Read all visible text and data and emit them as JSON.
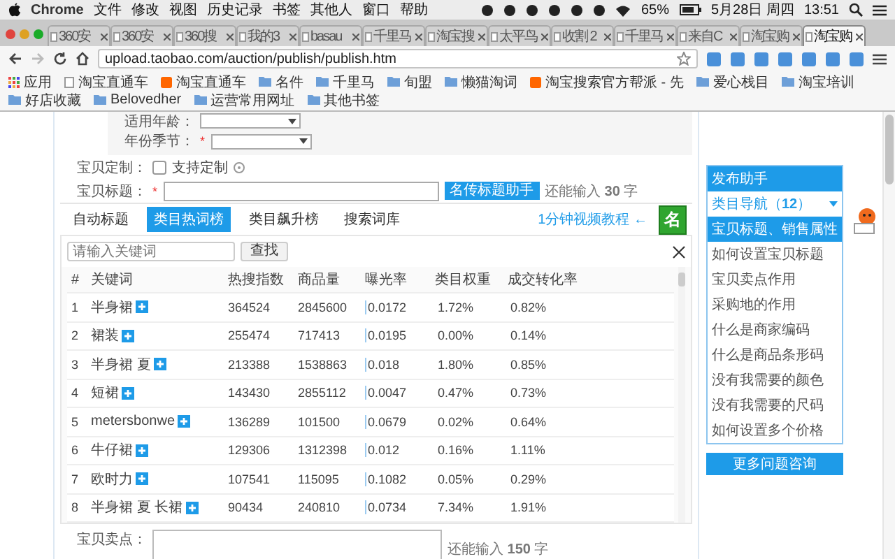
{
  "menu_bar": {
    "app": "Chrome",
    "menus": [
      "文件",
      "修改",
      "视图",
      "历史记录",
      "书签",
      "其他人",
      "窗口",
      "帮助"
    ],
    "battery": "65%",
    "date": "5月28日 周四",
    "time": "13:51"
  },
  "tabs": [
    {
      "label": "360安",
      "selected": false
    },
    {
      "label": "360安",
      "selected": false
    },
    {
      "label": "360搜",
      "selected": false
    },
    {
      "label": "我的3",
      "selected": false
    },
    {
      "label": "basau",
      "selected": false
    },
    {
      "label": "千里马",
      "selected": false
    },
    {
      "label": "淘宝搜",
      "selected": false
    },
    {
      "label": "太平鸟",
      "selected": false
    },
    {
      "label": "收割 2",
      "selected": false
    },
    {
      "label": "千里马",
      "selected": false
    },
    {
      "label": "来自C",
      "selected": false
    },
    {
      "label": "淘宝购",
      "selected": false
    },
    {
      "label": "淘宝购",
      "selected": true
    }
  ],
  "address_bar": {
    "url": "upload.taobao.com/auction/publish/publish.htm"
  },
  "bookmarks": [
    {
      "label": "应用",
      "kind": "apps"
    },
    {
      "label": "淘宝直通车",
      "kind": "page"
    },
    {
      "label": "淘宝直通车",
      "kind": "site"
    },
    {
      "label": "名件",
      "kind": "folder"
    },
    {
      "label": "千里马",
      "kind": "folder"
    },
    {
      "label": "旬盟",
      "kind": "folder"
    },
    {
      "label": "懒猫淘词",
      "kind": "folder"
    },
    {
      "label": "淘宝搜索官方帮派 - 先",
      "kind": "site"
    },
    {
      "label": "爱心栈目",
      "kind": "folder"
    },
    {
      "label": "淘宝培训",
      "kind": "folder"
    },
    {
      "label": "好店收藏",
      "kind": "folder"
    },
    {
      "label": "Belovedher",
      "kind": "folder"
    },
    {
      "label": "运营常用网址",
      "kind": "folder"
    },
    {
      "label": "其他书签",
      "kind": "folder"
    }
  ],
  "form": {
    "age_label": "适用年龄：",
    "season_label": "年份季节：",
    "required_mark": "*",
    "custom_label": "宝贝定制：",
    "custom_option": {
      "label": "支持定制",
      "checked": false
    },
    "title_label": "宝贝标题：",
    "title_button": "名传标题助手",
    "title_hint": "还能输入 **30** 字"
  },
  "tool_tabs": [
    {
      "label": "自动标题",
      "selected": false
    },
    {
      "label": "类目热词榜",
      "selected": true
    },
    {
      "label": "类目飙升榜",
      "selected": false
    },
    {
      "label": "搜索词库",
      "selected": false
    }
  ],
  "tutorial_link": "1分钟视频教程 ←",
  "logo": "名",
  "search": {
    "placeholder": "请输入关键词",
    "button": "查找"
  },
  "table": {
    "columns": [
      "#",
      "关键词",
      "热搜指数",
      "商品量",
      "曝光率",
      "类目权重",
      "成交转化率"
    ],
    "rows": [
      [
        "1",
        "半身裙",
        "364524",
        "2845600",
        "0.0172",
        "1.72%",
        "0.82%"
      ],
      [
        "2",
        "裙装",
        "255474",
        "717413",
        "0.0195",
        "0.00%",
        "0.14%"
      ],
      [
        "3",
        "半身裙 夏",
        "213388",
        "1538863",
        "0.018",
        "1.80%",
        "0.85%"
      ],
      [
        "4",
        "短裙",
        "143430",
        "2855112",
        "0.0047",
        "0.47%",
        "0.73%"
      ],
      [
        "5",
        "metersbonwe",
        "136289",
        "101500",
        "0.0679",
        "0.02%",
        "0.64%"
      ],
      [
        "6",
        "牛仔裙",
        "129306",
        "1312398",
        "0.012",
        "0.16%",
        "1.11%"
      ],
      [
        "7",
        "欧时力",
        "107541",
        "115095",
        "0.1082",
        "0.05%",
        "0.29%"
      ],
      [
        "8",
        "半身裙 夏 长裙",
        "90434",
        "240810",
        "0.0734",
        "7.34%",
        "1.91%"
      ]
    ]
  },
  "selling_points": {
    "label": "宝贝卖点：",
    "hint": "还能输入 **150** 字"
  },
  "assistant": {
    "title": "发布助手",
    "nav": "类目导航（**12**）",
    "topic": "宝贝标题、销售属性",
    "links": [
      "如何设置宝贝标题",
      "宝贝卖点作用",
      "采购地的作用",
      "什么是商家编码",
      "什么是商品条形码",
      "没有我需要的颜色",
      "没有我需要的尺码",
      "如何设置多个价格"
    ],
    "more_button": "更多问题咨询"
  }
}
